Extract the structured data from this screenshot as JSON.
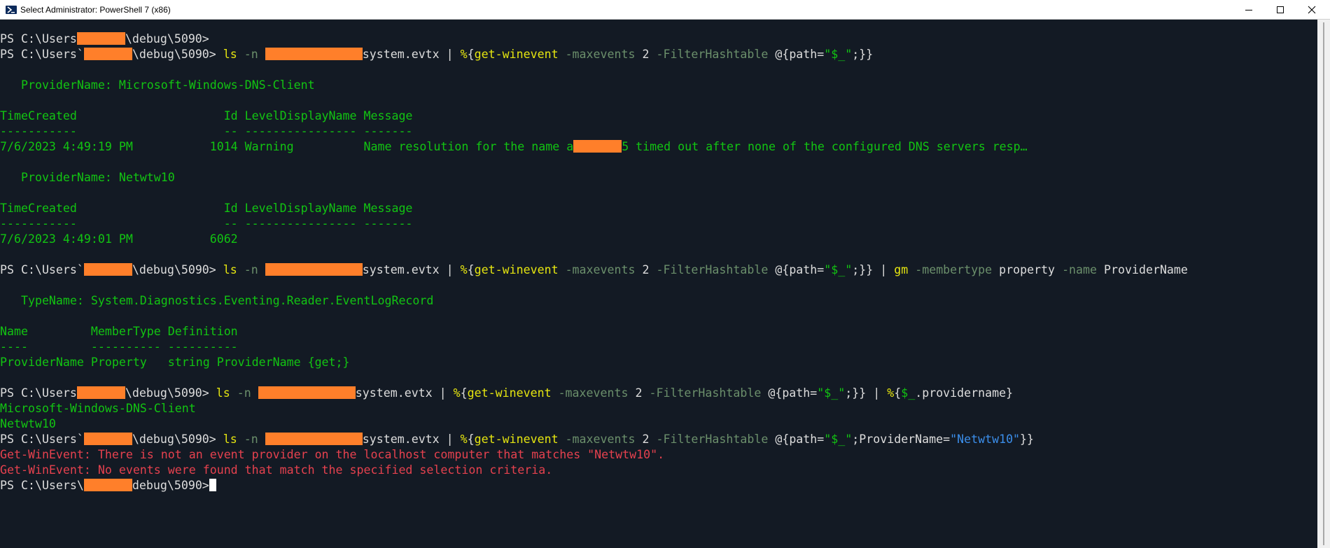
{
  "window": {
    "title": "Select Administrator: PowerShell 7 (x86)",
    "icons": {
      "app": "powershell-icon",
      "minimize": "minimize-icon",
      "maximize": "maximize-icon",
      "close": "close-icon"
    },
    "colors": {
      "background": "#131a24",
      "output": "#12c412",
      "error": "#e5414e",
      "redaction": "#ff7f2a"
    }
  },
  "t": {
    "ps_prefix": "PS C:\\Users",
    "ps_suffix": "\\debug\\5090>",
    "ps_suffix_last": "debug\\5090>",
    "space": " ",
    "ls": "ls",
    "n": "-n",
    "evtx": "system.evtx",
    "pipe": "|",
    "foreach": "%",
    "lbrace": "{",
    "getwinevent": "get-winevent",
    "maxevents": "-maxevents",
    "two": "2",
    "filterhashtable": "-FilterHashtable",
    "hashstart": "@{",
    "path": "path",
    "eq": "=",
    "dollar_str": "\"$_\"",
    "semicolon": ";",
    "closebraces": "}}",
    "closebrace": "}",
    "gm": "gm",
    "membertype": "-membertype",
    "property": "property",
    "name": "-name",
    "providername_arg": "ProviderName",
    "dollar_var": "$_",
    "providername_member": ".providername",
    "providername_key": "ProviderName",
    "netwtw_str": "\"Netwtw10\"",
    "backtick": "`"
  },
  "output": {
    "provider1": "   ProviderName: Microsoft-Windows-DNS-Client",
    "header1": "TimeCreated                     Id LevelDisplayName Message",
    "underline1": "-----------                     -- ---------------- -------",
    "row1_a": "7/6/2023 4:49:19 PM           1014 Warning          Name resolution for the name a",
    "row1_b": "5 timed out after none of the configured DNS servers resp…",
    "provider2": "   ProviderName: Netwtw10",
    "header2": "TimeCreated                     Id LevelDisplayName Message",
    "underline2": "-----------                     -- ---------------- -------",
    "row2": "7/6/2023 4:49:01 PM           6062",
    "typename": "   TypeName: System.Diagnostics.Eventing.Reader.EventLogRecord",
    "header3": "Name         MemberType Definition",
    "underline3": "----         ---------- ----------",
    "row3": "ProviderName Property   string ProviderName {get;}",
    "result1": "Microsoft-Windows-DNS-Client",
    "result2": "Netwtw10",
    "error1": "Get-WinEvent: There is not an event provider on the localhost computer that matches \"Netwtw10\".",
    "error2": "Get-WinEvent: No events were found that match the specified selection criteria."
  }
}
